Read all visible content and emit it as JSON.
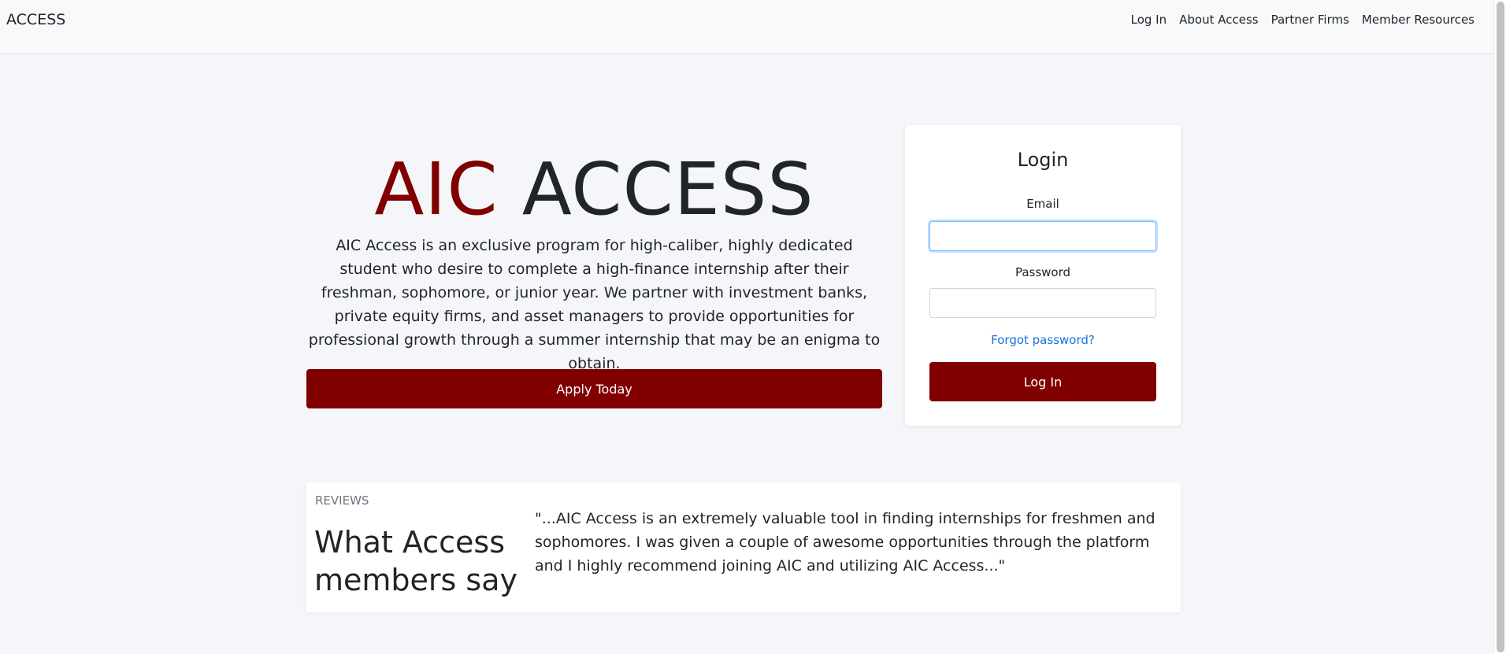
{
  "navbar": {
    "brand": "ACCESS",
    "links": [
      "Log In",
      "About Access",
      "Partner Firms",
      "Member Resources"
    ]
  },
  "hero": {
    "title_accent": "AIC",
    "title_rest": "ACCESS",
    "description": "AIC Access is an exclusive program for high-caliber, highly dedicated student who desire to complete a high-finance internship after their freshman, sophomore, or junior year. We partner with investment banks, private equity firms, and asset managers to provide opportunities for professional growth through a summer internship that may be an enigma to obtain.",
    "apply_label": "Apply Today"
  },
  "login": {
    "title": "Login",
    "email_label": "Email",
    "email_value": "",
    "password_label": "Password",
    "password_value": "",
    "forgot_label": "Forgot password?",
    "submit_label": "Log In"
  },
  "reviews": {
    "eyebrow": "Reviews",
    "heading": "What Access members say",
    "quote": "\"...AIC Access is an extremely valuable tool in finding internships for freshmen and sophomores. I was given a couple of awesome opportunities through the platform and I highly recommend joining AIC and utilizing AIC Access...\""
  },
  "colors": {
    "accent": "#800000",
    "link": "#1a73d9"
  }
}
